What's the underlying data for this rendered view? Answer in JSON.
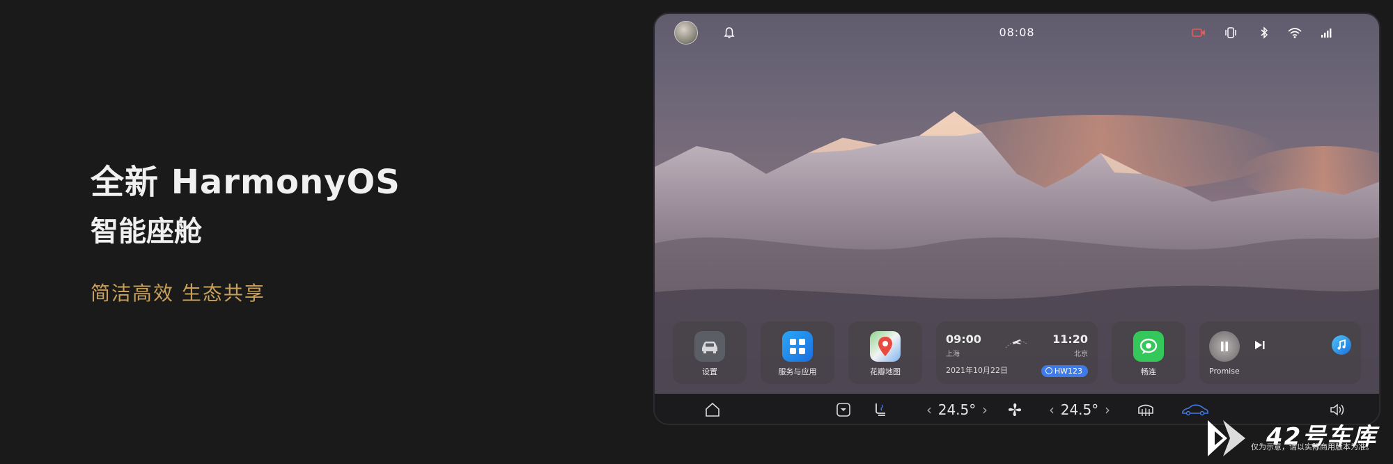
{
  "promo": {
    "title_line1": "全新 HarmonyOS",
    "title_line2": "智能座舱",
    "tagline": "简洁高效 生态共享",
    "tagline_color": "#c8a05a"
  },
  "status_bar": {
    "time": "08:08",
    "left_icons": [
      "avatar",
      "bell-icon"
    ],
    "right_icons": [
      "dashcam-icon",
      "vibrate-icon",
      "bluetooth-icon",
      "wifi-icon",
      "signal-icon"
    ]
  },
  "cards": {
    "settings": {
      "label": "设置",
      "icon": "car-icon"
    },
    "services": {
      "label": "服务与应用",
      "icon": "grid-apps-icon"
    },
    "maps": {
      "label": "花瓣地图",
      "icon": "map-pin-icon"
    },
    "flight": {
      "depart_time": "09:00",
      "depart_city": "上海",
      "arrive_time": "11:20",
      "arrive_city": "北京",
      "date": "2021年10月22日",
      "flight_no": "HW123",
      "icon": "airplane-icon"
    },
    "changlian": {
      "label": "畅连",
      "icon": "chat-bubble-icon"
    },
    "music": {
      "song": "Promise",
      "icons": [
        "pause-icon",
        "next-track-icon",
        "music-app-icon"
      ]
    }
  },
  "dock": {
    "icons": [
      "home-icon",
      "dropdown-icon",
      "seat-heat-icon",
      "fan-icon",
      "defrost-icon",
      "car-outline-icon",
      "volume-icon"
    ],
    "left_temp": "24.5°",
    "right_temp": "24.5°",
    "arrow_left": "‹",
    "arrow_right": "›"
  },
  "watermark": {
    "brand": "42号车库",
    "note": "仅为示意，请以实际商用版本为准。"
  },
  "colors": {
    "accent_blue": "#3f7be8",
    "page_bg": "#1a1a1a"
  }
}
